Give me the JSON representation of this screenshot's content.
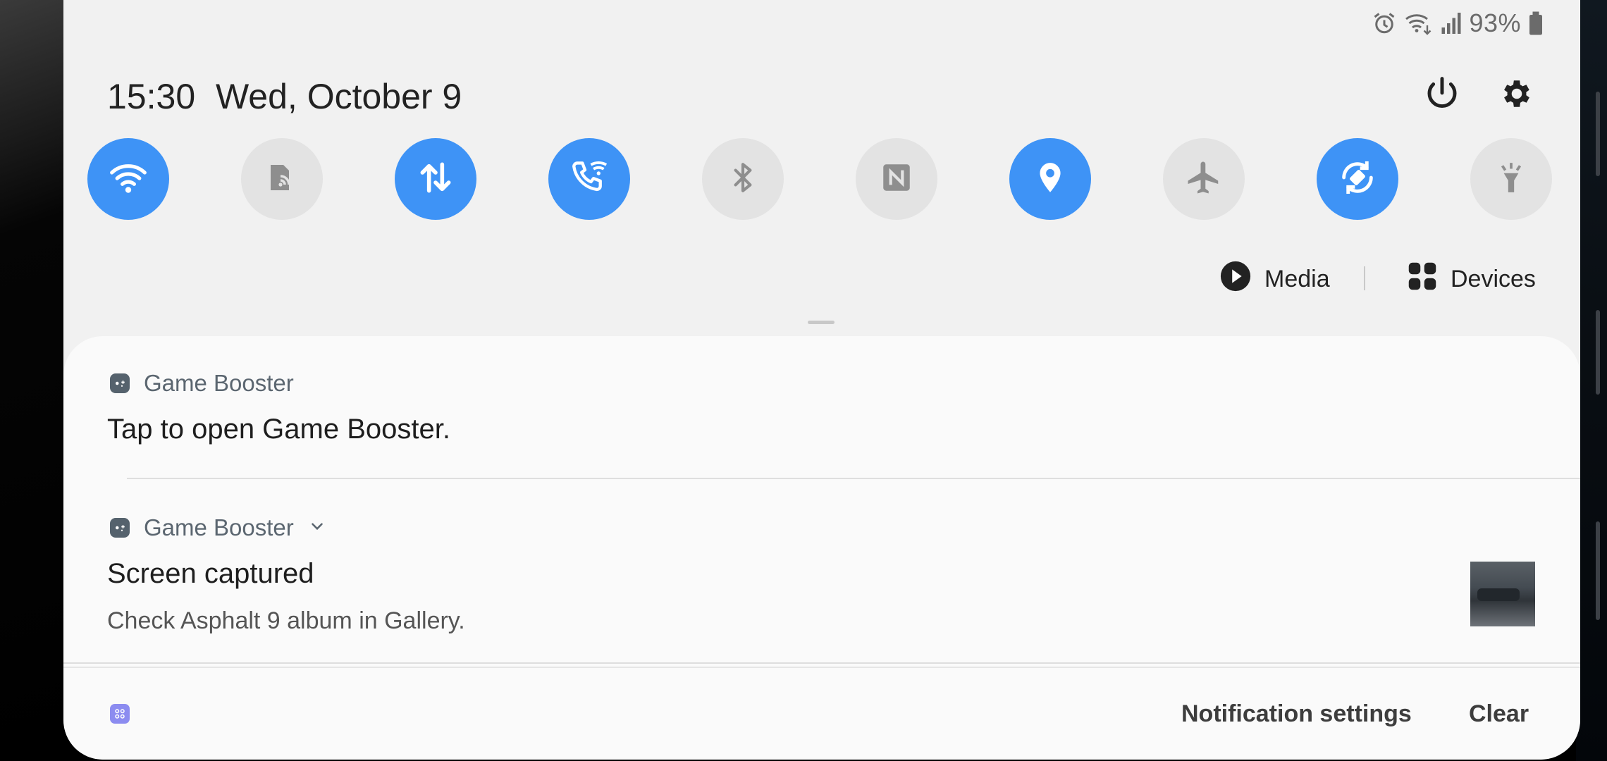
{
  "status_bar": {
    "icons": [
      "alarm-icon",
      "wifi-calling-icon",
      "signal-icon",
      "battery-icon"
    ],
    "battery_pct": "93%"
  },
  "header": {
    "time": "15:30",
    "date": "Wed, October 9",
    "power_icon": "power-icon",
    "settings_icon": "gear-icon"
  },
  "quick_tiles": [
    {
      "name": "wifi",
      "icon": "wifi-icon",
      "active": true
    },
    {
      "name": "mobile-hotspot",
      "icon": "hotspot-icon",
      "active": false
    },
    {
      "name": "mobile-data",
      "icon": "data-arrows-icon",
      "active": true
    },
    {
      "name": "wifi-calling",
      "icon": "wifi-calling-icon",
      "active": true
    },
    {
      "name": "bluetooth",
      "icon": "bluetooth-icon",
      "active": false
    },
    {
      "name": "nfc",
      "icon": "nfc-icon",
      "active": false
    },
    {
      "name": "location",
      "icon": "location-pin-icon",
      "active": true
    },
    {
      "name": "airplane-mode",
      "icon": "airplane-icon",
      "active": false
    },
    {
      "name": "auto-rotate",
      "icon": "auto-rotate-icon",
      "active": true
    },
    {
      "name": "flashlight",
      "icon": "flashlight-icon",
      "active": false
    }
  ],
  "colors": {
    "tile_on": "#3e93f6",
    "tile_off": "#e3e3e3",
    "panel_bg": "#f1f1f1"
  },
  "media": {
    "label": "Media"
  },
  "devices": {
    "label": "Devices"
  },
  "notifications": [
    {
      "app": "Game Booster",
      "title": "Tap to open Game Booster."
    },
    {
      "app": "Game Booster",
      "title": "Screen captured",
      "text": "Check Asphalt 9 album in Gallery."
    }
  ],
  "footer": {
    "settings_label": "Notification settings",
    "clear_label": "Clear"
  }
}
